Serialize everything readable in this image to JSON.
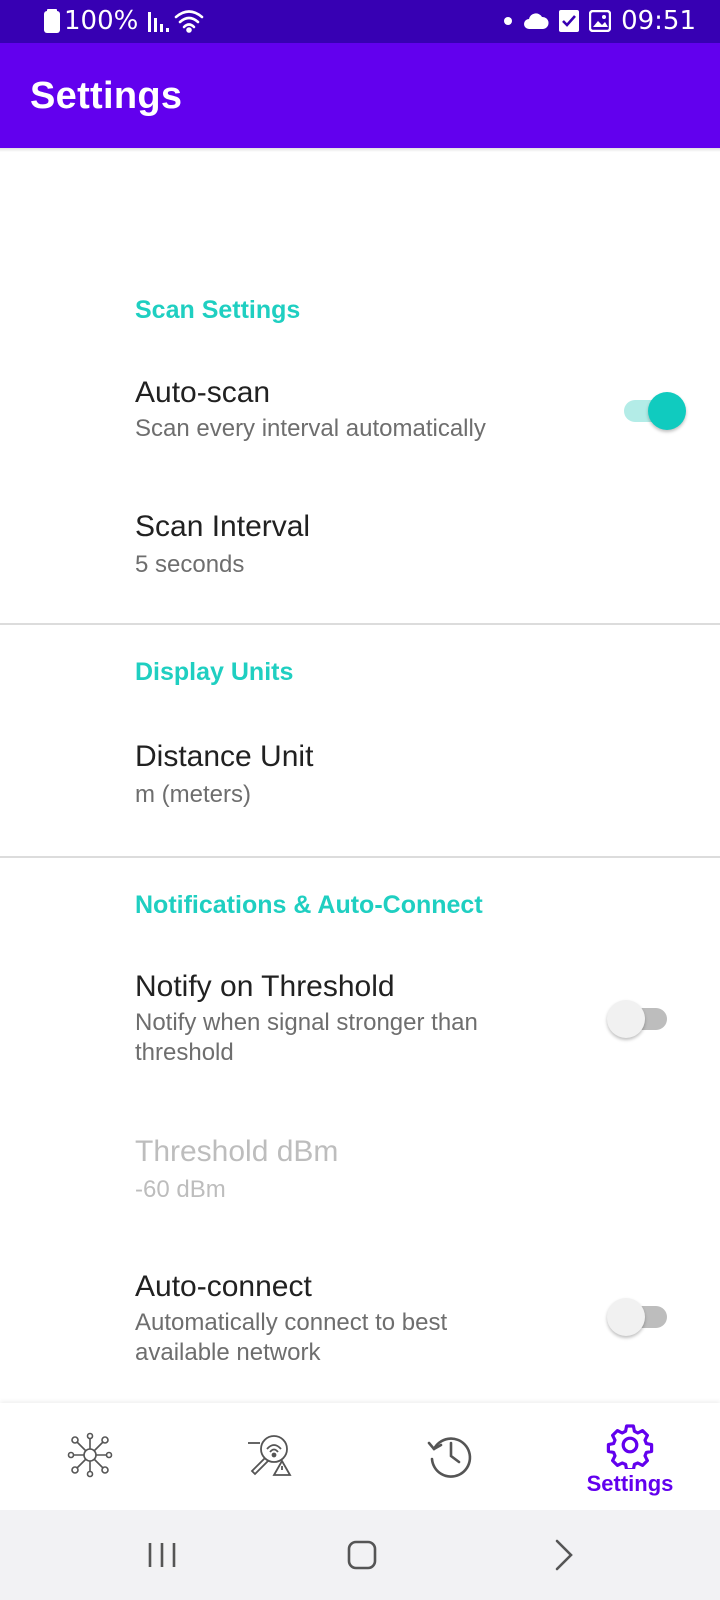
{
  "status_bar": {
    "battery_percent": "100%",
    "time": "09:51",
    "icons": [
      "battery-icon",
      "signal-icon",
      "wifi-icon",
      "dot-icon",
      "cloud-icon",
      "check-box-icon",
      "image-icon"
    ]
  },
  "app_bar": {
    "title": "Settings"
  },
  "sections": {
    "scan": {
      "header": "Scan Settings",
      "auto_scan": {
        "title": "Auto-scan",
        "summary": "Scan every interval automatically",
        "enabled": true
      },
      "scan_interval": {
        "title": "Scan Interval",
        "summary": "5 seconds"
      }
    },
    "display": {
      "header": "Display Units",
      "distance_unit": {
        "title": "Distance Unit",
        "summary": "m (meters)"
      }
    },
    "notifications": {
      "header": "Notifications & Auto-Connect",
      "notify_threshold": {
        "title": "Notify on Threshold",
        "summary_line1": "Notify when signal stronger than",
        "summary_line2": "threshold",
        "enabled": false
      },
      "threshold_dbm": {
        "title": "Threshold dBm",
        "summary": "-60 dBm",
        "disabled": true
      },
      "auto_connect": {
        "title": "Auto-connect",
        "summary_line1": "Automatically connect to best",
        "summary_line2": "available network",
        "enabled": false
      }
    }
  },
  "bottom_nav": {
    "items": [
      {
        "icon": "network-nodes-icon",
        "label": ""
      },
      {
        "icon": "scan-search-icon",
        "label": ""
      },
      {
        "icon": "history-icon",
        "label": ""
      },
      {
        "icon": "gear-icon",
        "label": "Settings",
        "active": true
      }
    ]
  },
  "colors": {
    "status_bar": "#3700b3",
    "app_bar": "#6200ee",
    "accent": "#10cbbf",
    "category": "#1fcfc1"
  }
}
